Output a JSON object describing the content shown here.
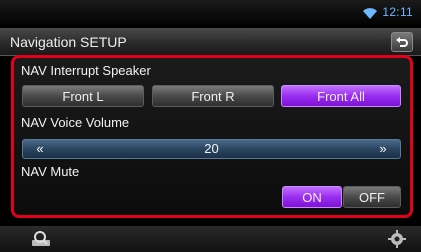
{
  "status": {
    "time": "12:11"
  },
  "header": {
    "title": "Navigation SETUP"
  },
  "settings": {
    "interrupt_speaker": {
      "label": "NAV Interrupt Speaker",
      "options": [
        "Front L",
        "Front R",
        "Front All"
      ],
      "selected": "Front All"
    },
    "voice_volume": {
      "label": "NAV Voice Volume",
      "decrease_label": "«",
      "increase_label": "»",
      "value": "20"
    },
    "mute": {
      "label": "NAV Mute",
      "on_label": "ON",
      "off_label": "OFF",
      "selected": "ON"
    }
  },
  "colors": {
    "accent": "#9a2ef0",
    "highlight_border": "#e2001a",
    "clock": "#6fb8ff"
  },
  "icons": {
    "back": "back-arrow-icon",
    "wifi": "wifi-icon",
    "search": "search-icon",
    "settings": "gear-icon"
  }
}
